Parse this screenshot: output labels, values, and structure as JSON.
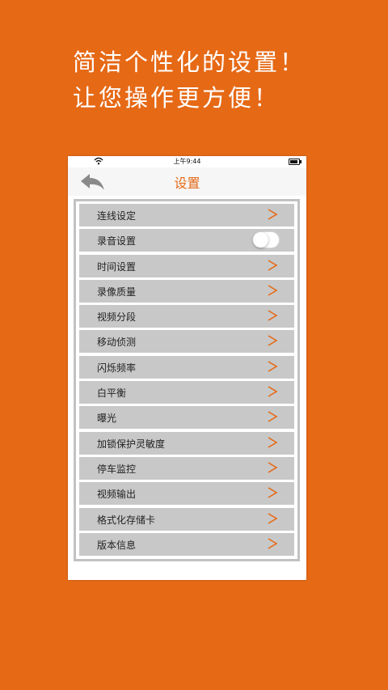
{
  "promo": {
    "line1": "简洁个性化的设置！",
    "line2": "让您操作更方便！"
  },
  "status_bar": {
    "time": "上午9:44"
  },
  "nav": {
    "title": "设置",
    "back_icon": "back-arrow-icon"
  },
  "colors": {
    "background": "#e66916",
    "accent": "#e66916",
    "row": "#c8c8c8"
  },
  "settings": {
    "items": [
      {
        "label": "连线设定",
        "control": "chevron"
      },
      {
        "label": "录音设置",
        "control": "toggle",
        "on": false
      },
      {
        "label": "时间设置",
        "control": "chevron"
      },
      {
        "label": "录像质量",
        "control": "chevron"
      },
      {
        "label": "视频分段",
        "control": "chevron"
      },
      {
        "label": "移动侦测",
        "control": "chevron"
      },
      {
        "label": "闪烁频率",
        "control": "chevron"
      },
      {
        "label": "白平衡",
        "control": "chevron"
      },
      {
        "label": "曝光",
        "control": "chevron"
      },
      {
        "label": "加锁保护灵敏度",
        "control": "chevron"
      },
      {
        "label": "停车监控",
        "control": "chevron"
      },
      {
        "label": "视频输出",
        "control": "chevron"
      },
      {
        "label": "格式化存储卡",
        "control": "chevron"
      },
      {
        "label": "版本信息",
        "control": "chevron"
      }
    ]
  }
}
